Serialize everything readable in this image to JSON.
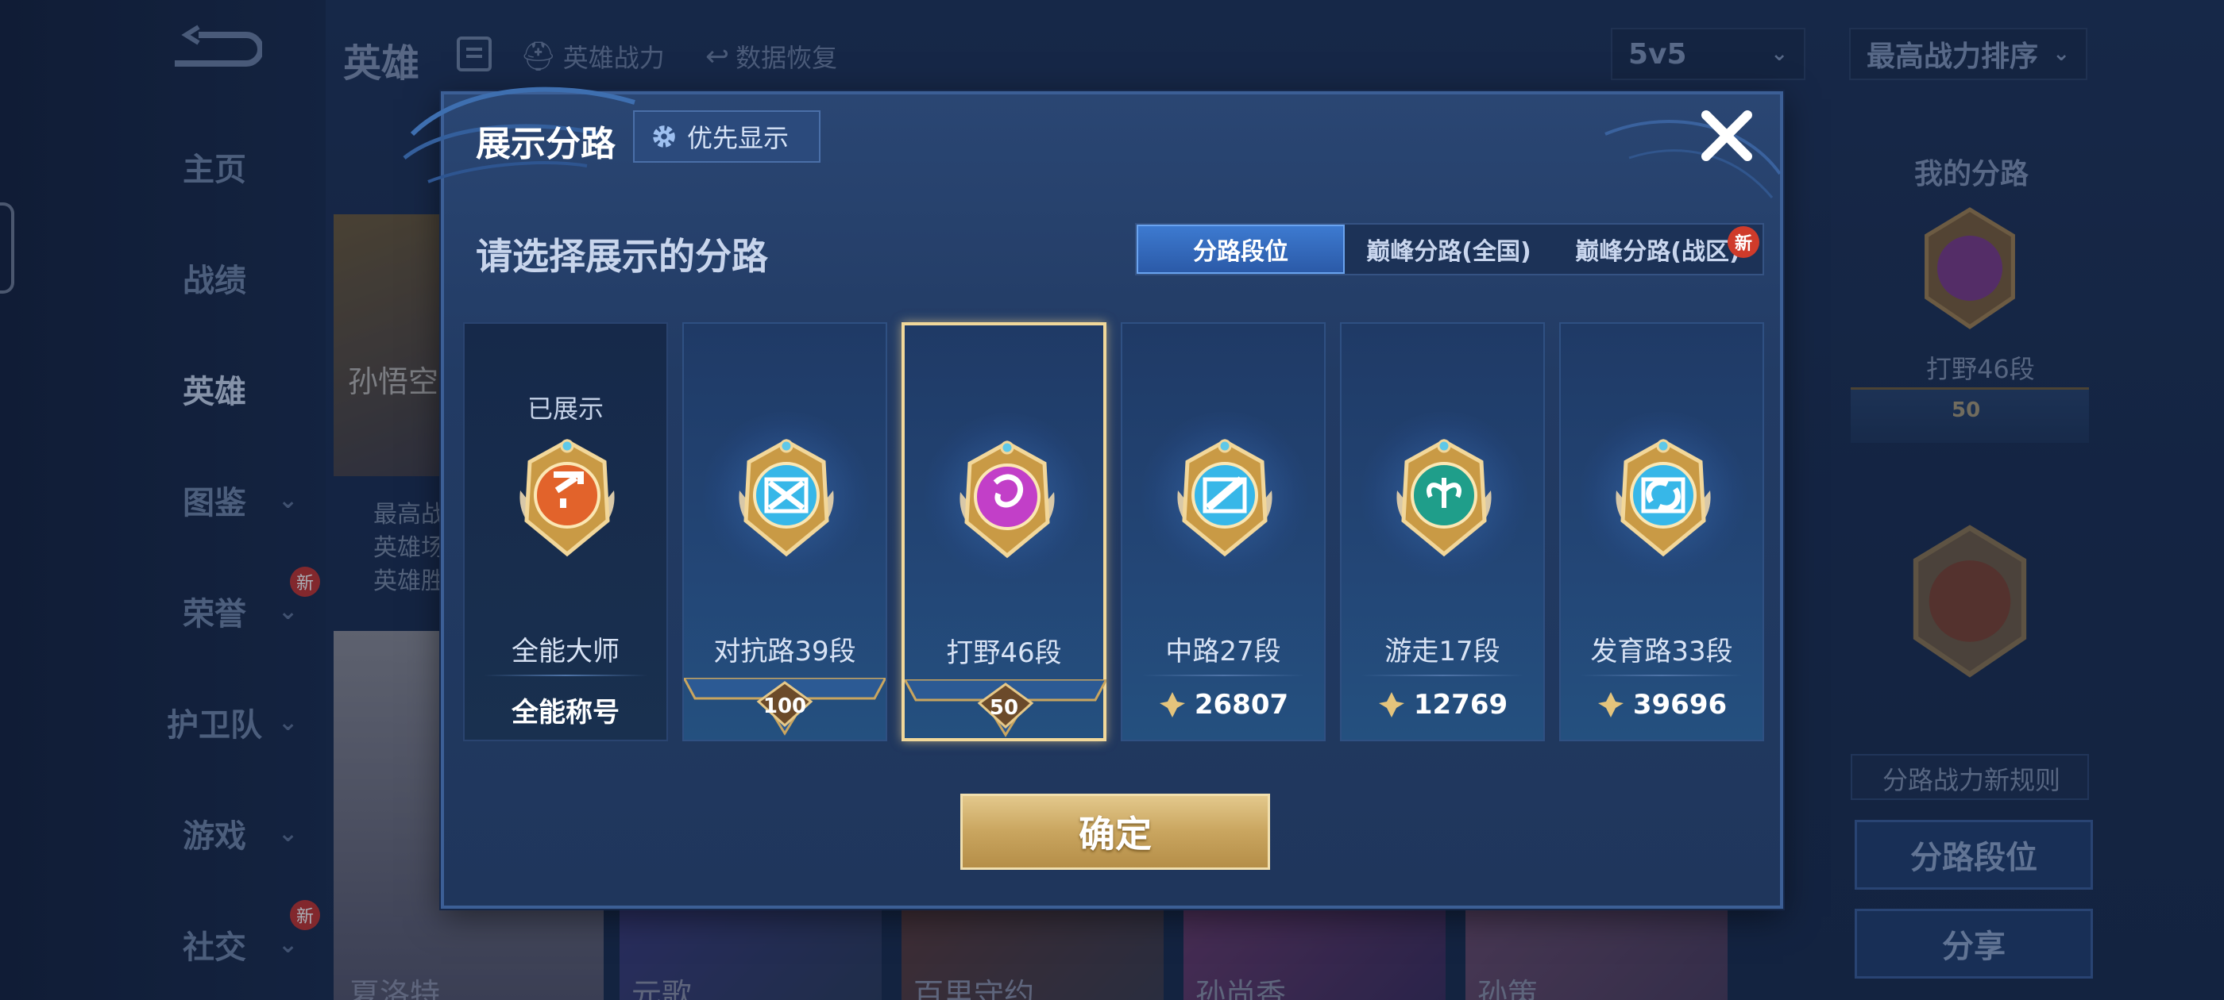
{
  "background": {
    "title": "英雄",
    "top_items": [
      "英雄战力",
      "数据恢复"
    ],
    "mode_select": "5v5",
    "sort_select": "最高战力排序",
    "nav": [
      {
        "label": "主页",
        "chevron": false,
        "new": false
      },
      {
        "label": "战绩",
        "chevron": false,
        "new": false
      },
      {
        "label": "英雄",
        "chevron": false,
        "new": false,
        "active": true
      },
      {
        "label": "图鉴",
        "chevron": true,
        "new": false
      },
      {
        "label": "荣誉",
        "chevron": true,
        "new": true
      },
      {
        "label": "护卫队",
        "chevron": true,
        "new": false
      },
      {
        "label": "游戏",
        "chevron": true,
        "new": false
      },
      {
        "label": "社交",
        "chevron": true,
        "new": true
      }
    ],
    "new_badge": "新",
    "hero_top_name": "孙悟空",
    "hero_stats": [
      "最高战",
      "英雄场",
      "英雄胜"
    ],
    "hero_row_names": [
      "夏洛特",
      "元歌",
      "百里守约",
      "孙尚香",
      "孙策"
    ],
    "right_panel": {
      "title": "我的分路",
      "current_lane": "打野46段",
      "current_rank": "50",
      "rule_text": "分路战力新规则",
      "lane_button": "分路段位",
      "share_button": "分享"
    }
  },
  "modal": {
    "title": "展示分路",
    "priority_button": "优先显示",
    "subtitle": "请选择展示的分路",
    "tabs": [
      {
        "label": "分路段位",
        "active": true
      },
      {
        "label": "巅峰分路(全国)",
        "active": false
      },
      {
        "label": "巅峰分路(战区)",
        "active": false,
        "new": "新"
      }
    ],
    "cards": [
      {
        "name": "全能大师",
        "status": "已展示",
        "bottom": "全能称号",
        "color": "#e2632b",
        "icon": "allround-icon"
      },
      {
        "name": "对抗路39段",
        "rank": "100",
        "color": "#37b7e8",
        "icon": "clash-lane-icon"
      },
      {
        "name": "打野46段",
        "rank": "50",
        "color": "#c23fc8",
        "icon": "jungle-icon",
        "selected": true
      },
      {
        "name": "中路27段",
        "power": "26807",
        "color": "#37b7e8",
        "icon": "mid-lane-icon"
      },
      {
        "name": "游走17段",
        "power": "12769",
        "color": "#1f9e8a",
        "icon": "roam-icon"
      },
      {
        "name": "发育路33段",
        "power": "39696",
        "color": "#37b7e8",
        "icon": "farm-lane-icon"
      }
    ],
    "confirm_button": "确定"
  }
}
